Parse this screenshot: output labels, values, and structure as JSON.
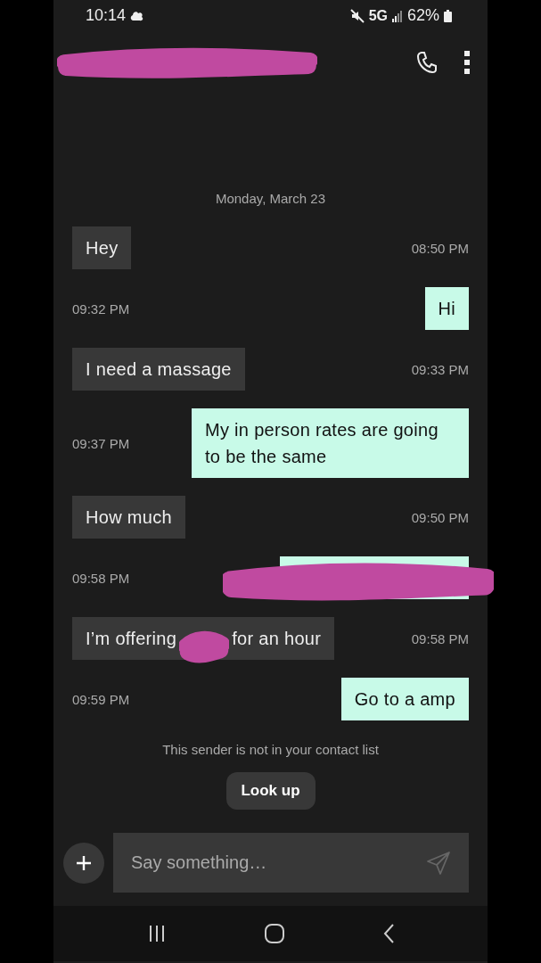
{
  "status_bar": {
    "time": "10:14",
    "network": "5G",
    "battery": "62%"
  },
  "header": {
    "title_redacted": true
  },
  "date": "Monday, March 23",
  "messages": [
    {
      "kind": "received",
      "redacted": false,
      "text": "Hey",
      "time": "08:50 PM"
    },
    {
      "kind": "sent",
      "redacted": false,
      "text": "Hi",
      "time": "09:32 PM"
    },
    {
      "kind": "received",
      "redacted": false,
      "text": "I need a massage",
      "time": "09:33 PM"
    },
    {
      "kind": "sent",
      "redacted": false,
      "text": "My in person rates are going to be the same",
      "time": "09:37 PM"
    },
    {
      "kind": "received",
      "redacted": false,
      "text": "How much",
      "time": "09:50 PM"
    },
    {
      "kind": "sent",
      "redacted": true,
      "time": "09:58 PM"
    },
    {
      "kind": "received",
      "redacted": true,
      "parts": [
        "I’m offering",
        "for an hour"
      ],
      "time": "09:58 PM"
    },
    {
      "kind": "sent",
      "redacted": false,
      "text": "Go to a amp",
      "time": "09:59 PM"
    }
  ],
  "notice": "This sender is not in your contact list",
  "lookup_button": "Look up",
  "composer": {
    "placeholder": "Say something…"
  }
}
